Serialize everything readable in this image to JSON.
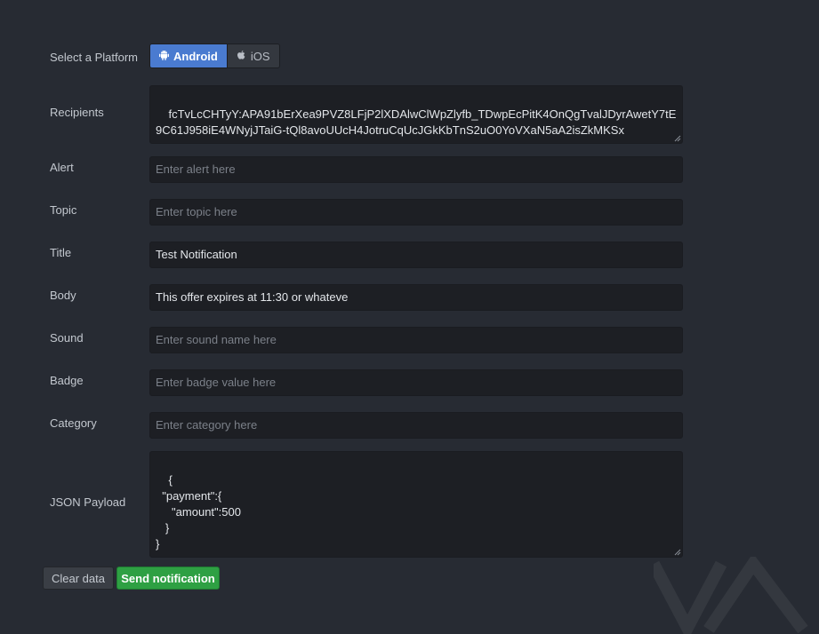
{
  "platform": {
    "label": "Select a Platform",
    "options": [
      {
        "label": "Android",
        "icon": "android-icon",
        "selected": true
      },
      {
        "label": "iOS",
        "icon": "apple-icon",
        "selected": false
      }
    ]
  },
  "fields": {
    "recipients": {
      "label": "Recipients",
      "value": "fcTvLcCHTyY:APA91bErXea9PVZ8LFjP2lXDAlwClWpZlyfb_TDwpEcPitK4OnQgTvalJDyrAwetY7tE9C61J958iE4WNyjJTaiG-tQl8avoUUcH4JotruCqUcJGkKbTnS2uO0YoVXaN5aA2isZkMKSx"
    },
    "alert": {
      "label": "Alert",
      "placeholder": "Enter alert here",
      "value": ""
    },
    "topic": {
      "label": "Topic",
      "placeholder": "Enter topic here",
      "value": ""
    },
    "title": {
      "label": "Title",
      "placeholder": "",
      "value": "Test Notification"
    },
    "body": {
      "label": "Body",
      "placeholder": "",
      "value": "This offer expires at 11:30 or whateve"
    },
    "sound": {
      "label": "Sound",
      "placeholder": "Enter sound name here",
      "value": ""
    },
    "badge": {
      "label": "Badge",
      "placeholder": "Enter badge value here",
      "value": ""
    },
    "category": {
      "label": "Category",
      "placeholder": "Enter category here",
      "value": ""
    },
    "json_payload": {
      "label": "JSON Payload",
      "value": "{\n  \"payment\":{\n     \"amount\":500\n   }\n}"
    }
  },
  "actions": {
    "clear_label": "Clear data",
    "send_label": "Send notification"
  },
  "colors": {
    "background": "#272b33",
    "field_bg": "#1d1f24",
    "primary": "#4a7bd0",
    "success": "#2ea043"
  }
}
